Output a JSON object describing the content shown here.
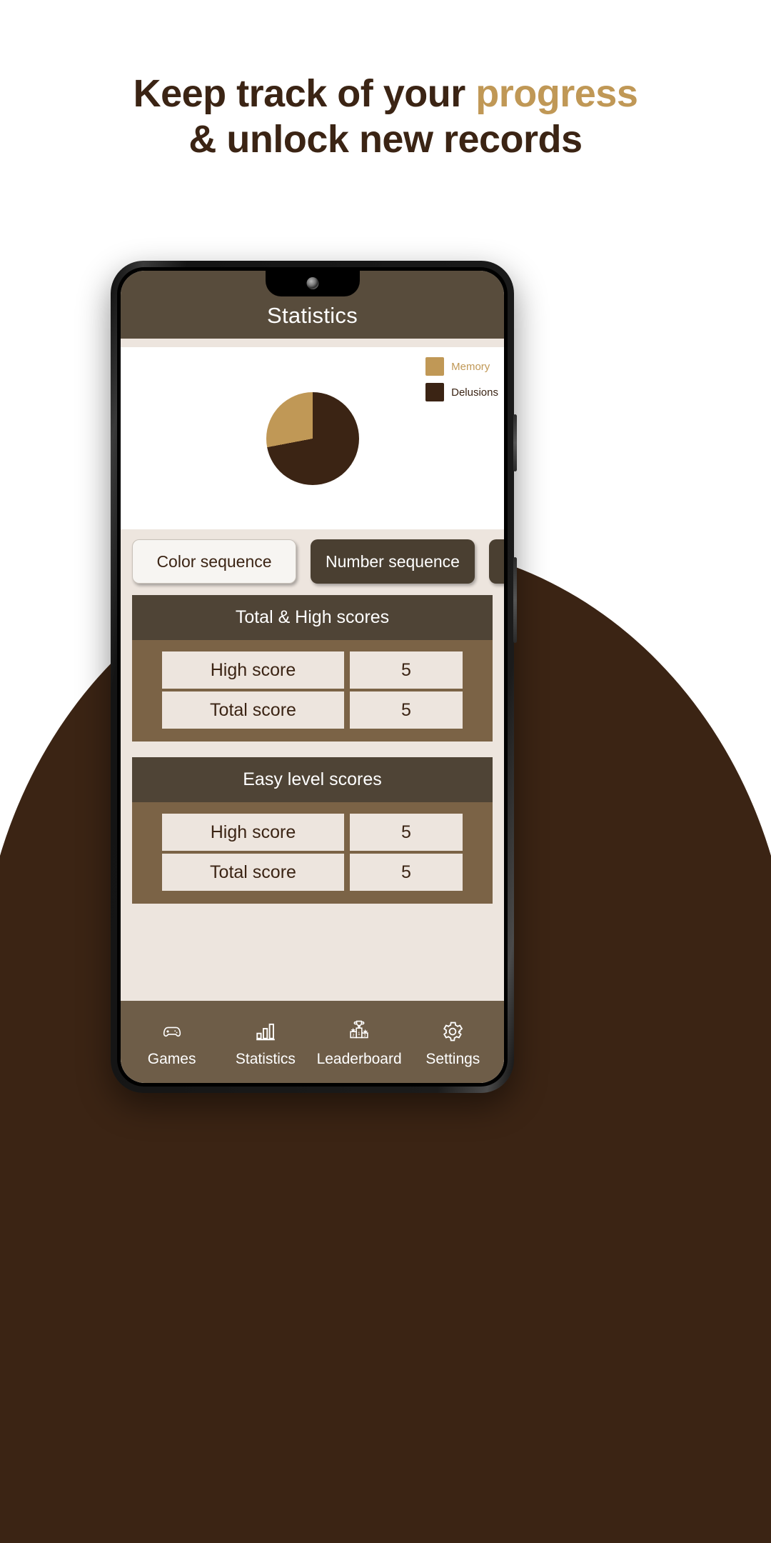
{
  "headline": {
    "line1_a": "Keep track of your ",
    "line1_accent": "progress",
    "line2": "& unlock new records"
  },
  "colors": {
    "brand_dark": "#3B2414",
    "brand_accent": "#C09856",
    "header_bar": "#584C3C",
    "panel_head": "#4F4436",
    "panel_body": "#7B6346",
    "nav_bar": "#6E5D48",
    "screen_bg": "#EDE5DE"
  },
  "app": {
    "header": {
      "title": "Statistics"
    },
    "chart_data": {
      "type": "pie",
      "title": "",
      "legend_position": "top-right",
      "categories": [
        "Memory",
        "Delusions"
      ],
      "values": [
        28,
        72
      ],
      "colors": [
        "#C09856",
        "#3B2414"
      ],
      "legend": [
        {
          "label": "Memory",
          "color": "#C09856"
        },
        {
          "label": "Delusions",
          "color": "#3B2414"
        }
      ]
    },
    "tabs": [
      {
        "label": "Color sequence",
        "active": false
      },
      {
        "label": "Number sequence",
        "active": true
      },
      {
        "label": "",
        "active": false
      }
    ],
    "panels": [
      {
        "title": "Total & High scores",
        "rows": [
          {
            "label": "High score",
            "value": "5"
          },
          {
            "label": "Total score",
            "value": "5"
          }
        ]
      },
      {
        "title": "Easy level scores",
        "rows": [
          {
            "label": "High score",
            "value": "5"
          },
          {
            "label": "Total score",
            "value": "5"
          }
        ]
      }
    ],
    "bottom_nav": [
      {
        "label": "Games",
        "icon": "gamepad-icon"
      },
      {
        "label": "Statistics",
        "icon": "bar-chart-icon"
      },
      {
        "label": "Leaderboard",
        "icon": "podium-icon"
      },
      {
        "label": "Settings",
        "icon": "gear-icon"
      }
    ]
  }
}
